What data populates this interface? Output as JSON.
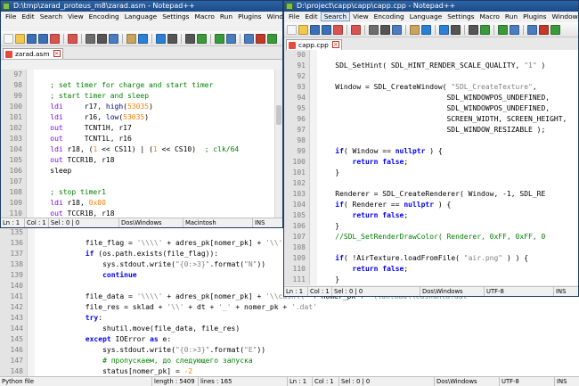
{
  "asm_window": {
    "title": "D:\\tmp\\zarad_proteus_m8\\zarad.asm - Notepad++",
    "menu": [
      "File",
      "Edit",
      "Search",
      "View",
      "Encoding",
      "Language",
      "Settings",
      "Macro",
      "Run",
      "Plugins",
      "Window",
      "?"
    ],
    "tab": "zarad.asm",
    "lines": [
      {
        "n": "97",
        "html": ""
      },
      {
        "n": "98",
        "html": "    <span class='cm'>; set timer for charge and start timer</span>"
      },
      {
        "n": "99",
        "html": "    <span class='cm'>; start timer and sleep</span>"
      },
      {
        "n": "100",
        "html": "    <span class='kw2'>ldi</span>     r17, <span class='fn'>high</span>(<span class='num'>53035</span>)"
      },
      {
        "n": "101",
        "html": "    <span class='kw2'>ldi</span>     r16, <span class='fn'>low</span>(<span class='num'>53035</span>)"
      },
      {
        "n": "102",
        "html": "    <span class='kw2'>out</span>     TCNT1H, r17"
      },
      {
        "n": "103",
        "html": "    <span class='kw2'>out</span>     TCNT1L, r16"
      },
      {
        "n": "104",
        "html": "    <span class='kw2'>ldi</span> r18, (<span class='num'>1</span> &lt;&lt; CS11) | (<span class='num'>1</span> &lt;&lt; CS10)  <span class='cm'>; clk/64</span>"
      },
      {
        "n": "105",
        "html": "    <span class='kw2'>out</span> TCCR1B, r18"
      },
      {
        "n": "106",
        "html": "    sleep"
      },
      {
        "n": "107",
        "html": ""
      },
      {
        "n": "108",
        "html": "    <span class='cm'>; stop timer1</span>"
      },
      {
        "n": "109",
        "html": "    <span class='kw2'>ldi</span> r18, <span class='num'>0x00</span>"
      },
      {
        "n": "110",
        "html": "    <span class='kw2'>out</span> TCCR1B, r18"
      },
      {
        "n": "111",
        "html": ""
      }
    ],
    "status": {
      "ln": "Ln : 1",
      "col": "Col : 1",
      "sel": "Sel : 0 | 0",
      "eol": "Dos\\Windows",
      "enc": "Macintosh",
      "ins": "INS"
    }
  },
  "cpp_window": {
    "title": "D:\\project\\capp\\capp\\capp.cpp - Notepad++",
    "menu": [
      "File",
      "Edit",
      "Search",
      "View",
      "Encoding",
      "Language",
      "Settings",
      "Macro",
      "Run",
      "Plugins",
      "Window",
      "?"
    ],
    "active_menu": "Search",
    "tab": "capp.cpp",
    "lines": [
      {
        "n": "90",
        "html": ""
      },
      {
        "n": "91",
        "html": "    SDL_SetHint( SDL_HINT_RENDER_SCALE_QUALITY, <span class='str'>\"1\"</span> )"
      },
      {
        "n": "92",
        "html": ""
      },
      {
        "n": "93",
        "html": "    Window = SDL_CreateWindow( <span class='str'>\"SDL_CreateTexture\"</span>,"
      },
      {
        "n": "94",
        "html": "                              SDL_WINDOWPOS_UNDEFINED,"
      },
      {
        "n": "95",
        "html": "                              SDL_WINDOWPOS_UNDEFINED,"
      },
      {
        "n": "96",
        "html": "                              SCREEN_WIDTH, SCREEN_HEIGHT,"
      },
      {
        "n": "97",
        "html": "                              SDL_WINDOW_RESIZABLE );"
      },
      {
        "n": "98",
        "html": ""
      },
      {
        "n": "99",
        "html": "    <span class='kw'>if</span>( Window == <span class='kw'>nullptr</span> ) {"
      },
      {
        "n": "100",
        "html": "        <span class='kw'>return</span> <span class='kw'>false</span>;"
      },
      {
        "n": "101",
        "html": "    }"
      },
      {
        "n": "102",
        "html": ""
      },
      {
        "n": "103",
        "html": "    Renderer = SDL_CreateRenderer( Window, -1, SDL_RE"
      },
      {
        "n": "104",
        "html": "    <span class='kw'>if</span>( Renderer == <span class='kw'>nullptr</span> ) {"
      },
      {
        "n": "105",
        "html": "        <span class='kw'>return</span> <span class='kw'>false</span>;"
      },
      {
        "n": "106",
        "html": "    }"
      },
      {
        "n": "107",
        "html": "    <span class='cm'>//SDL_SetRenderDrawColor( Renderer, 0xFF, 0xFF, 0</span>"
      },
      {
        "n": "108",
        "html": ""
      },
      {
        "n": "109",
        "html": "    <span class='kw'>if</span>( !AirTexture.loadFromFile( <span class='str'>\"air.png\"</span> ) ) {"
      },
      {
        "n": "110",
        "html": "        <span class='kw'>return</span> <span class='kw'>false</span>;"
      },
      {
        "n": "111",
        "html": "    }"
      },
      {
        "n": "112",
        "html": ""
      },
      {
        "n": "113",
        "html": "    gAirTexture.initCoords( 100, 100 );"
      }
    ],
    "status": {
      "ln": "Ln : 1",
      "col": "Col : 1",
      "sel": "Sel : 0 | 0",
      "eol": "Dos\\Windows",
      "enc": "UTF-8",
      "ins": "INS"
    }
  },
  "py_window": {
    "lines": [
      {
        "n": "135",
        "html": ""
      },
      {
        "n": "136",
        "html": "            file_flag = <span class='str'>'\\\\\\\\'</span> + adres_pk[nomer_pk] + <span class='str'>'\\\\'</span>"
      },
      {
        "n": "137",
        "html": "            <span class='kw'>if</span> (os.path.exists(file_flag)):"
      },
      {
        "n": "138",
        "html": "                sys.stdout.write(<span class='str'>\"{0:&gt;3}\"</span>.format(<span class='str'>\"N\"</span>))"
      },
      {
        "n": "139",
        "html": "                <span class='kw'>continue</span>"
      },
      {
        "n": "140",
        "html": ""
      },
      {
        "n": "141",
        "html": "            file_data = <span class='str'>'\\\\\\\\'</span> + adres_pk[nomer_pk] + <span class='str'>'\\\\cash\\\\'</span> + nomer_pk + <span class='str'>'\\\\unload\\\\cashunld.dat'</span>"
      },
      {
        "n": "142",
        "html": "            file_res = sklad + <span class='str'>'\\\\'</span> + dt + <span class='str'>'_'</span> + nomer_pk + <span class='str'>'.dat'</span>"
      },
      {
        "n": "143",
        "html": "            <span class='kw'>try</span>:"
      },
      {
        "n": "144",
        "html": "                shutil.move(file_data, file_res)"
      },
      {
        "n": "145",
        "html": "            <span class='kw'>except</span> IOError <span class='kw'>as</span> e:"
      },
      {
        "n": "146",
        "html": "                sys.stdout.write(<span class='str'>\"{0:&gt;3}\"</span>.format(<span class='str'>\"E\"</span>))"
      },
      {
        "n": "147",
        "html": "                <span class='cm'># пропускаем, до следующего запуска</span>"
      },
      {
        "n": "148",
        "html": "                status[nomer_pk] = <span class='num'>-2</span>"
      }
    ],
    "status": {
      "type": "Python file",
      "length": "length : 5409",
      "lines": "lines : 165",
      "ln": "Ln : 1",
      "col": "Col : 1",
      "sel": "Sel : 0 | 0",
      "eol": "Dos\\Windows",
      "enc": "UTF-8",
      "ins": "INS"
    }
  },
  "toolbar_icons": [
    "new-file-icon",
    "open-file-icon",
    "save-icon",
    "save-all-icon",
    "close-icon",
    "close-all-icon",
    "print-icon",
    "cut-icon",
    "copy-icon",
    "paste-icon",
    "undo-icon",
    "redo-icon",
    "find-icon",
    "replace-icon",
    "zoom-in-icon",
    "zoom-out-icon",
    "sync-icon",
    "wrap-icon",
    "macro-record-icon",
    "macro-play-icon"
  ],
  "toolbar_colors": [
    "#f6f6f6",
    "#f2c94c",
    "#3b6fb6",
    "#3b6fb6",
    "#d9534f",
    "#d9534f",
    "#6d6d6d",
    "#555555",
    "#4a7dc0",
    "#c9a45c",
    "#2b7fd4",
    "#2b7fd4",
    "#555555",
    "#555555",
    "#3a9a3a",
    "#3a9a3a",
    "#4a7dc0",
    "#4a7dc0",
    "#c0392b",
    "#3a9a3a"
  ]
}
